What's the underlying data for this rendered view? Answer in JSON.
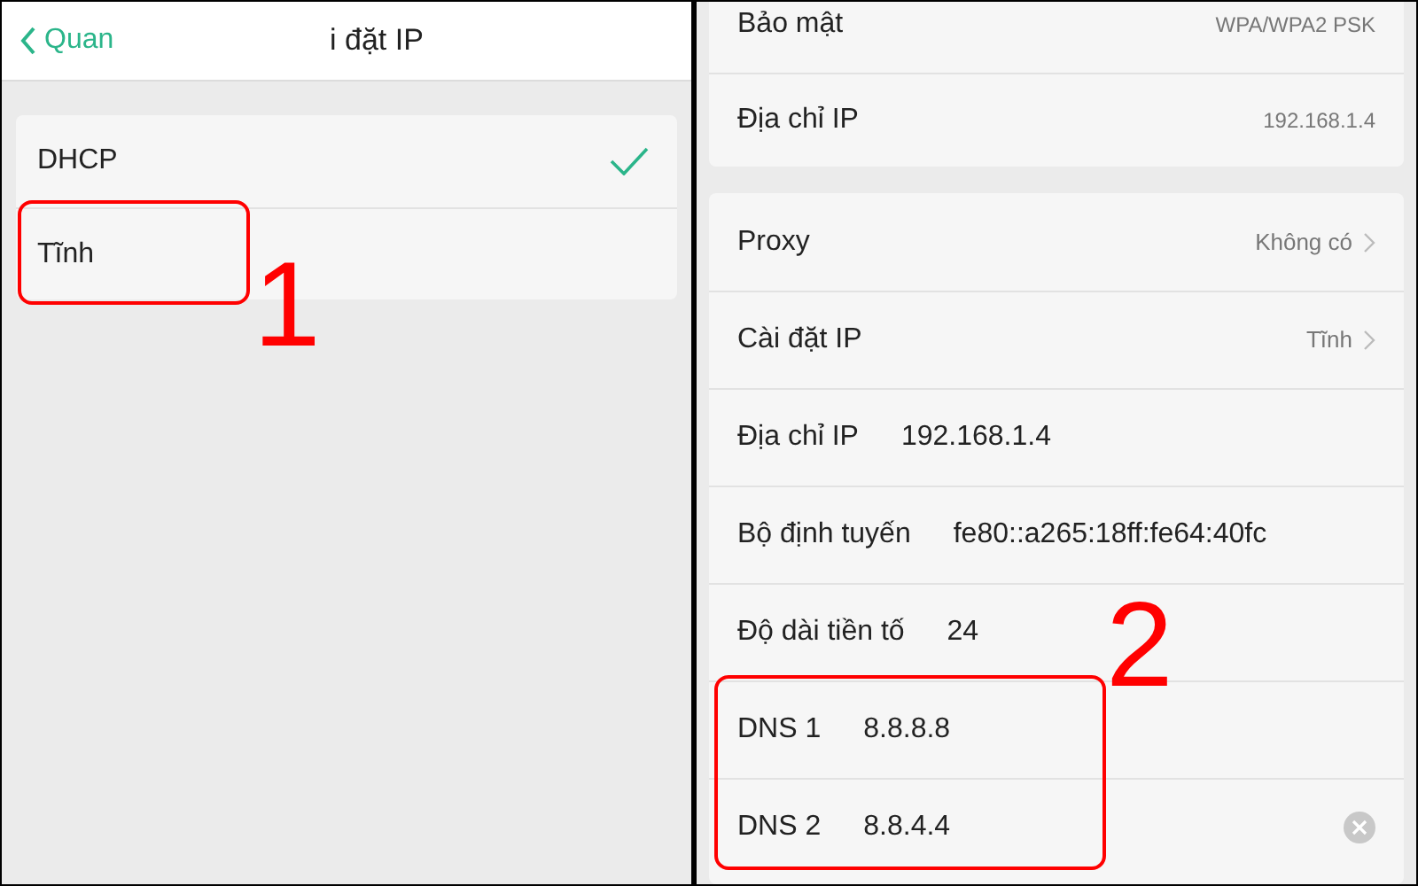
{
  "left_screen": {
    "header": {
      "back_label": "Quan",
      "title": "i đặt IP"
    },
    "options": [
      {
        "label": "DHCP",
        "selected": true
      },
      {
        "label": "Tĩnh",
        "selected": false
      }
    ]
  },
  "right_screen": {
    "groups": [
      {
        "rows": [
          {
            "kind": "detail",
            "label": "Bảo mật",
            "value": "WPA/WPA2 PSK"
          },
          {
            "kind": "detail",
            "label": "Địa chỉ IP",
            "value": "192.168.1.4"
          }
        ]
      },
      {
        "rows": [
          {
            "kind": "link",
            "label": "Proxy",
            "value": "Không có"
          },
          {
            "kind": "link",
            "label": "Cài đặt IP",
            "value": "Tĩnh"
          },
          {
            "kind": "field",
            "label": "Địa chỉ IP",
            "value": "192.168.1.4",
            "clear_button": false
          },
          {
            "kind": "field",
            "label": "Bộ định tuyến",
            "value": "fe80::a265:18ff:fe64:40fc",
            "clear_button": false
          },
          {
            "kind": "field",
            "label": "Độ dài tiền tố",
            "value": "24",
            "clear_button": false
          },
          {
            "kind": "field",
            "label": "DNS 1",
            "value": "8.8.8.8",
            "clear_button": false
          },
          {
            "kind": "field",
            "label": "DNS 2",
            "value": "8.8.4.4",
            "clear_button": true
          }
        ]
      }
    ]
  },
  "annotations": [
    {
      "label": "1"
    },
    {
      "label": "2"
    }
  ]
}
